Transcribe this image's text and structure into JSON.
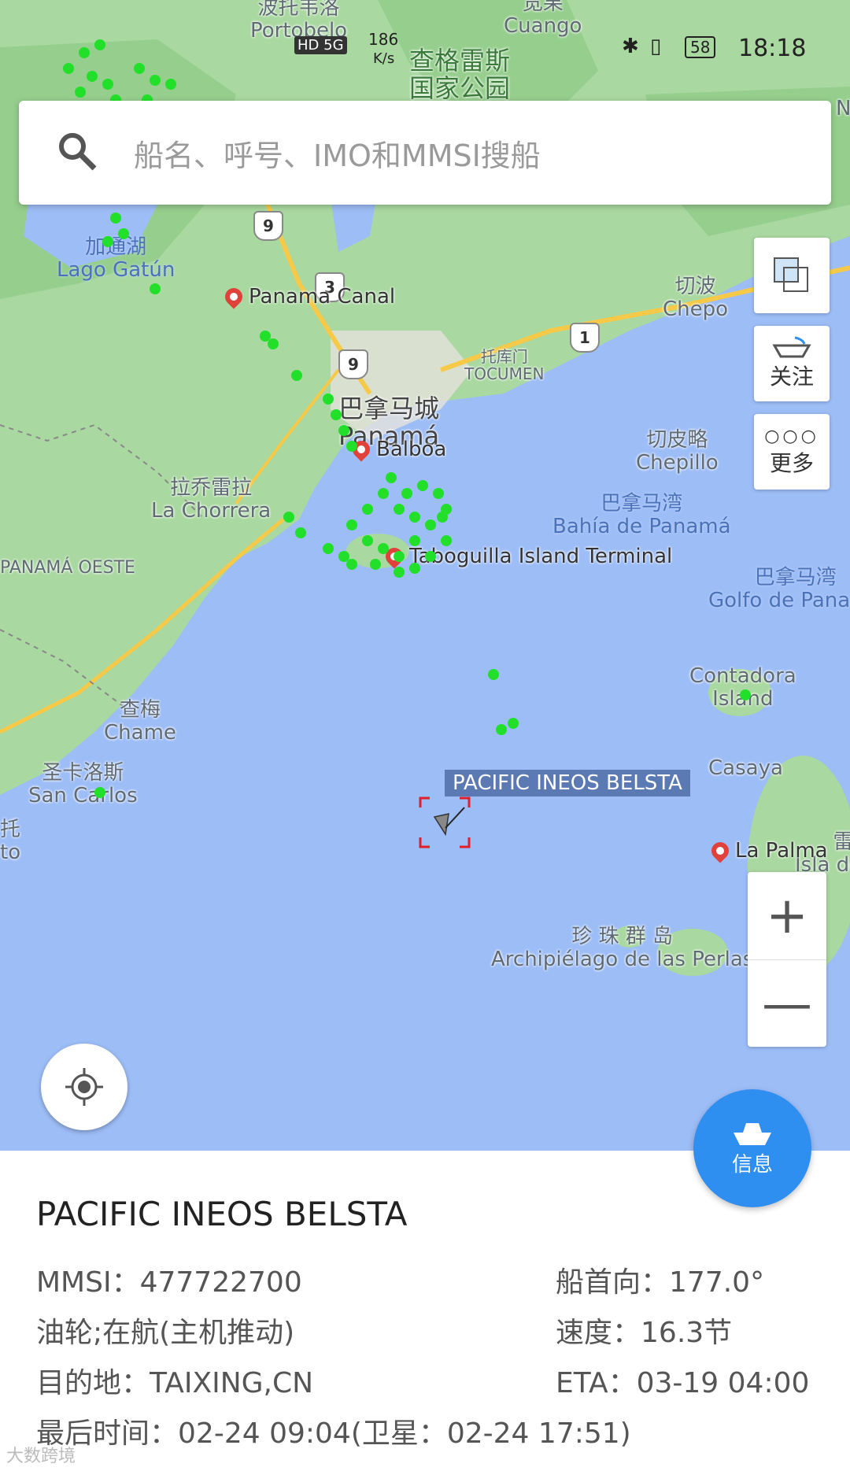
{
  "status_bar": {
    "network": "HD 5G",
    "speed_value": "186",
    "speed_unit": "K/s",
    "battery": "58",
    "time": "18:18"
  },
  "search": {
    "placeholder": "船名、呼号、IMO和MMSI搜船"
  },
  "side_buttons": {
    "follow_label": "关注",
    "more_label": "更多"
  },
  "zoom": {
    "in": "+",
    "out": "—"
  },
  "fab_label": "信息",
  "map": {
    "labels": {
      "portobelo": "波托韦洛\nPortobelo",
      "cuango": "宽果\nCuango",
      "chagres": "查格雷斯\n国家公园",
      "gatun": "加通湖\nLago Gatún",
      "chepo": "切波\nChepo",
      "tocumen": "托库门\nTOCUMEN",
      "panama_city": "巴拿马城\nPanamá",
      "chepillo": "切皮略\nChepillo",
      "bahia": "巴拿马湾\nBahía de Panamá",
      "golfo": "巴拿马湾\nGolfo de Panamá",
      "chorrera": "拉乔雷拉\nLa Chorrera",
      "oeste": "PANAMÁ OESTE",
      "contadora": "Contadora\nIsland",
      "chame": "查梅\nChame",
      "casaya": "Casaya",
      "san_carlos": "圣卡洛斯\nSan Carlos",
      "perlas": "珍 珠 群 岛\nArchipiélago de las Perlas",
      "rey": "雷伊\nIsla del Rey",
      "n_edge": "N",
      "to_edge": "托\nto"
    },
    "pois": {
      "panama_canal": "Panama Canal",
      "balboa": "Balboa",
      "taboguilla": "Taboguilla Island Terminal",
      "la_palma": "La Palma"
    },
    "routes": [
      "9",
      "3",
      "9",
      "1"
    ],
    "vessel_label": "PACIFIC INEOS BELSTA"
  },
  "vessel": {
    "name": "PACIFIC INEOS BELSTA",
    "mmsi_label": "MMSI：",
    "mmsi": "477722700",
    "heading_label": "船首向：",
    "heading": "177.0°",
    "type_status": "油轮;在航(主机推动)",
    "speed_label": "速度：",
    "speed": "16.3节",
    "destination_label": "目的地：",
    "destination": "TAIXING,CN",
    "eta_label": "ETA：",
    "eta": "03-19 04:00",
    "last_time_label": "最后时间：",
    "last_time": "02-24 09:04(卫星：02-24 17:51)"
  },
  "watermark": "大数跨境",
  "colors": {
    "water": "#9dbdf7",
    "land": "#a9d8a0",
    "ship_dots": "#22e02a",
    "accent": "#2f8ff0",
    "label_bg": "#5b79b3"
  }
}
